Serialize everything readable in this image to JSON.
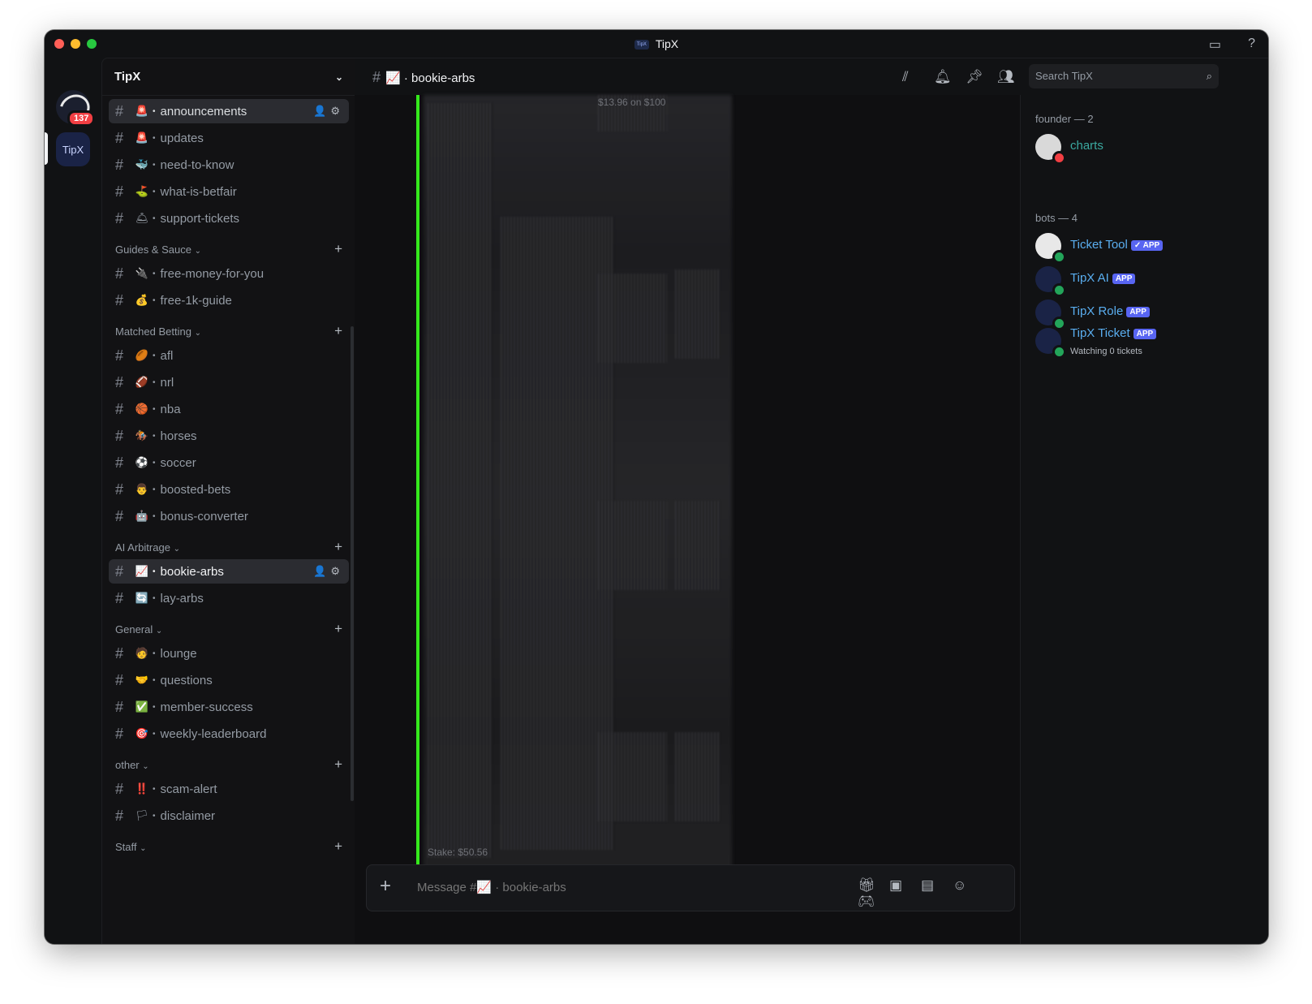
{
  "window": {
    "title": "TipX"
  },
  "rail": {
    "badge": "137",
    "server2_label": "TipX"
  },
  "server": {
    "name": "TipX"
  },
  "top_channels": [
    {
      "emoji": "🚨",
      "name": "announcements",
      "active_actions": "👥⚙"
    },
    {
      "emoji": "🚨",
      "name": "updates"
    },
    {
      "emoji": "🐳",
      "name": "need-to-know"
    },
    {
      "emoji": "⛳",
      "name": "what-is-betfair"
    },
    {
      "emoji": "🛎",
      "name": "support-tickets"
    }
  ],
  "categories": [
    {
      "name": "Guides & Sauce",
      "channels": [
        {
          "emoji": "🔌",
          "name": "free-money-for-you"
        },
        {
          "emoji": "💰",
          "name": "free-1k-guide"
        }
      ]
    },
    {
      "name": "Matched Betting",
      "channels": [
        {
          "emoji": "🏉",
          "name": "afl"
        },
        {
          "emoji": "🏈",
          "name": "nrl"
        },
        {
          "emoji": "🏀",
          "name": "nba"
        },
        {
          "emoji": "🏇",
          "name": "horses"
        },
        {
          "emoji": "⚽",
          "name": "soccer"
        },
        {
          "emoji": "👨",
          "name": "boosted-bets"
        },
        {
          "emoji": "🤖",
          "name": "bonus-converter"
        }
      ]
    },
    {
      "name": "AI Arbitrage",
      "channels": [
        {
          "emoji": "📈",
          "name": "bookie-arbs",
          "selected": true
        },
        {
          "emoji": "🔄",
          "name": "lay-arbs"
        }
      ]
    },
    {
      "name": "General",
      "channels": [
        {
          "emoji": "🧑",
          "name": "lounge"
        },
        {
          "emoji": "🤝",
          "name": "questions"
        },
        {
          "emoji": "✅",
          "name": "member-success"
        },
        {
          "emoji": "🎯",
          "name": "weekly-leaderboard"
        }
      ]
    },
    {
      "name": "other",
      "channels": [
        {
          "emoji": "‼️",
          "name": "scam-alert"
        },
        {
          "emoji": "🏳",
          "name": "disclaimer"
        }
      ]
    },
    {
      "name": "Staff",
      "channels": []
    }
  ],
  "channel_header": {
    "emoji": "📈",
    "name": "bookie-arbs"
  },
  "search": {
    "placeholder": "Search TipX"
  },
  "chat": {
    "top_snippet": "$13.96 on $100",
    "stake_snippet": "Stake: $50.56"
  },
  "composer": {
    "placeholder": "Message #📈 · bookie-arbs"
  },
  "members": {
    "founder_heading": "founder — 2",
    "founder": {
      "name": "charts"
    },
    "bots_heading": "bots — 4",
    "bots": [
      {
        "name": "Ticket Tool",
        "tag": "✓ APP",
        "sub": ""
      },
      {
        "name": "TipX AI",
        "tag": "APP",
        "sub": ""
      },
      {
        "name": "TipX Role",
        "tag": "APP",
        "sub": ""
      },
      {
        "name": "TipX Ticket",
        "tag": "APP",
        "sub": "Watching 0 tickets"
      }
    ]
  }
}
